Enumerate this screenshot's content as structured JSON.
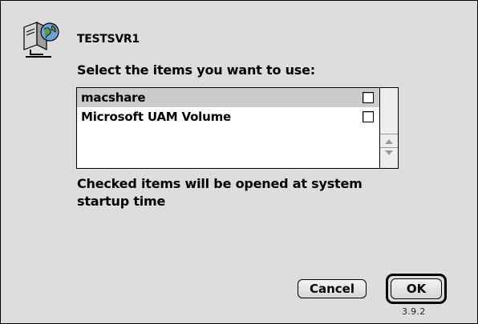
{
  "dialog": {
    "server_name": "TESTSVR1",
    "prompt": "Select the items you want to use:",
    "items": [
      {
        "label": "macshare",
        "checked": false,
        "selected": true
      },
      {
        "label": "Microsoft UAM Volume",
        "checked": false,
        "selected": false
      }
    ],
    "footnote": "Checked items will be opened at system startup time",
    "cancel_label": "Cancel",
    "ok_label": "OK",
    "version": "3.9.2"
  },
  "icons": {
    "server": "file-server-icon",
    "scroll_up": "scroll-up-arrow-icon",
    "scroll_down": "scroll-down-arrow-icon"
  },
  "colors": {
    "dialog_background": "#dddddd",
    "selected_row": "#cccccc"
  }
}
